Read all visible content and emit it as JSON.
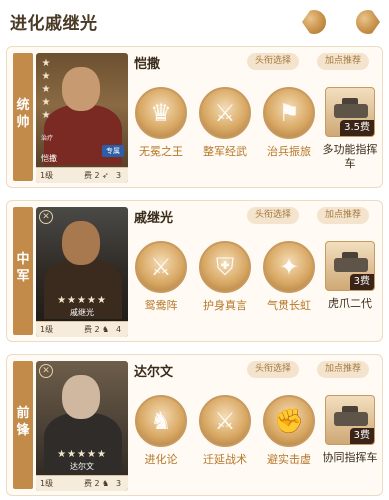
{
  "page": {
    "title": "进化戚继光"
  },
  "buttons": {
    "title_select": "头衔选择",
    "recommend": "加点推荐"
  },
  "heroes": [
    {
      "position": "统帅",
      "name": "恺撒",
      "stars": "★★★★★",
      "portrait_side_label": "治疗",
      "portrait_side_name": "恺撒",
      "portrait_badge": "专属",
      "level": "1级",
      "cost": "费 2",
      "troop_icon": "arrow-icon",
      "troop_value": "3",
      "skills": [
        {
          "name": "无冕之王",
          "icon": "helmet-icon",
          "glyph": "♛"
        },
        {
          "name": "整军经武",
          "icon": "soldiers-icon",
          "glyph": "⚔"
        },
        {
          "name": "治兵振旅",
          "icon": "banner-icon",
          "glyph": "⚑"
        }
      ],
      "tactic": {
        "name": "多功能指挥车",
        "cost": "3.5费",
        "icon": "command-vehicle-icon"
      }
    },
    {
      "position": "中军",
      "name": "戚继光",
      "stars": "★★★★★",
      "portrait_name": "戚继光",
      "level": "1级",
      "cost": "费 2",
      "troop_icon": "horse-icon",
      "troop_value": "4",
      "skills": [
        {
          "name": "鸳鸯阵",
          "icon": "spears-icon",
          "glyph": "⚔"
        },
        {
          "name": "护身真言",
          "icon": "shield-icon",
          "glyph": "⛨"
        },
        {
          "name": "气贯长虹",
          "icon": "warrior-icon",
          "glyph": "✦"
        }
      ],
      "tactic": {
        "name": "虎爪二代",
        "cost": "3费",
        "icon": "tank-icon"
      }
    },
    {
      "position": "前锋",
      "name": "达尔文",
      "stars": "★★★★★",
      "portrait_name": "达尔文",
      "level": "1级",
      "cost": "费 2",
      "troop_icon": "horse-icon",
      "troop_value": "3",
      "skills": [
        {
          "name": "进化论",
          "icon": "evolution-icon",
          "glyph": "♞"
        },
        {
          "name": "迁延战术",
          "icon": "soldier-icon",
          "glyph": "⚔"
        },
        {
          "name": "避实击虚",
          "icon": "fighter-icon",
          "glyph": "✊"
        }
      ],
      "tactic": {
        "name": "协同指挥车",
        "cost": "3费",
        "icon": "command-vehicle-icon"
      }
    }
  ]
}
